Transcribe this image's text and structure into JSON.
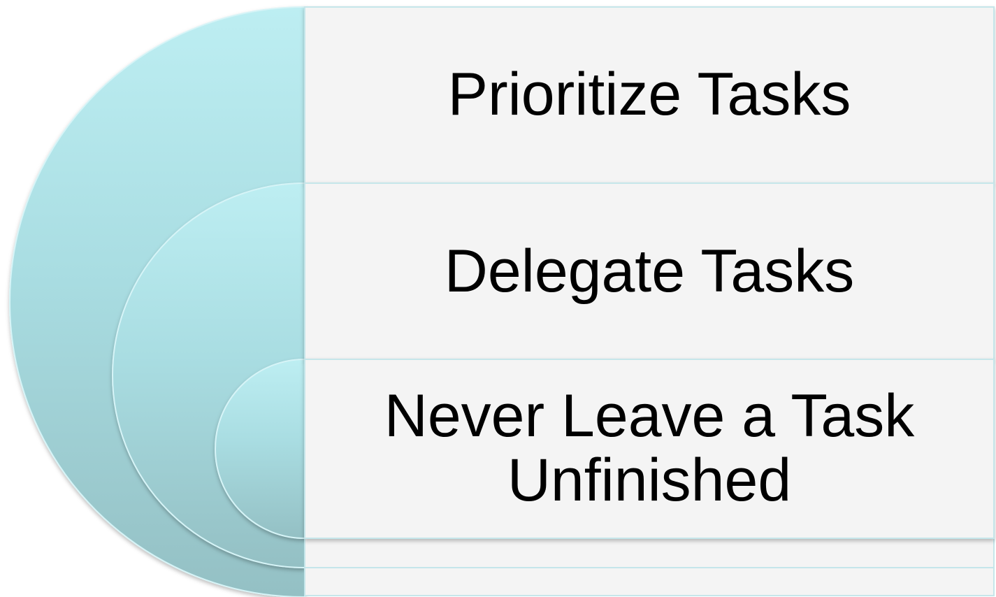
{
  "diagram": {
    "type": "nested-arc-list",
    "colors": {
      "arc_top": "#bdeef2",
      "arc_bottom": "#94c0c4",
      "arc_edge": "#d6f4f7",
      "box_fill": "#f4f4f4",
      "box_border": "#c5e6ea"
    },
    "items": [
      {
        "label": "Prioritize Tasks"
      },
      {
        "label": "Delegate Tasks"
      },
      {
        "label": "Never Leave a Task Unfinished"
      }
    ]
  }
}
